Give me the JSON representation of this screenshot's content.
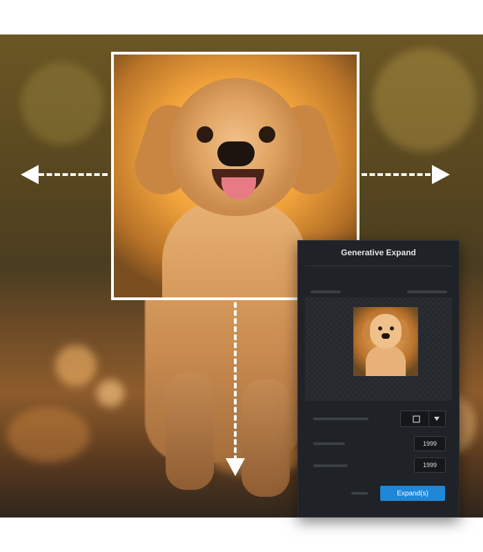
{
  "dialog": {
    "title": "Generative Expand",
    "width_value": "1999",
    "height_value": "1999",
    "aspect_icon": "square-icon",
    "dropdown_icon": "chevron-down-icon",
    "expand_label": "Expand(s)"
  },
  "overlay": {
    "arrows": [
      "arrow-left-icon",
      "arrow-right-icon",
      "arrow-down-icon"
    ]
  },
  "colors": {
    "accent": "#1f87d6",
    "panel": "#1f2226",
    "frame": "#ffffff"
  }
}
